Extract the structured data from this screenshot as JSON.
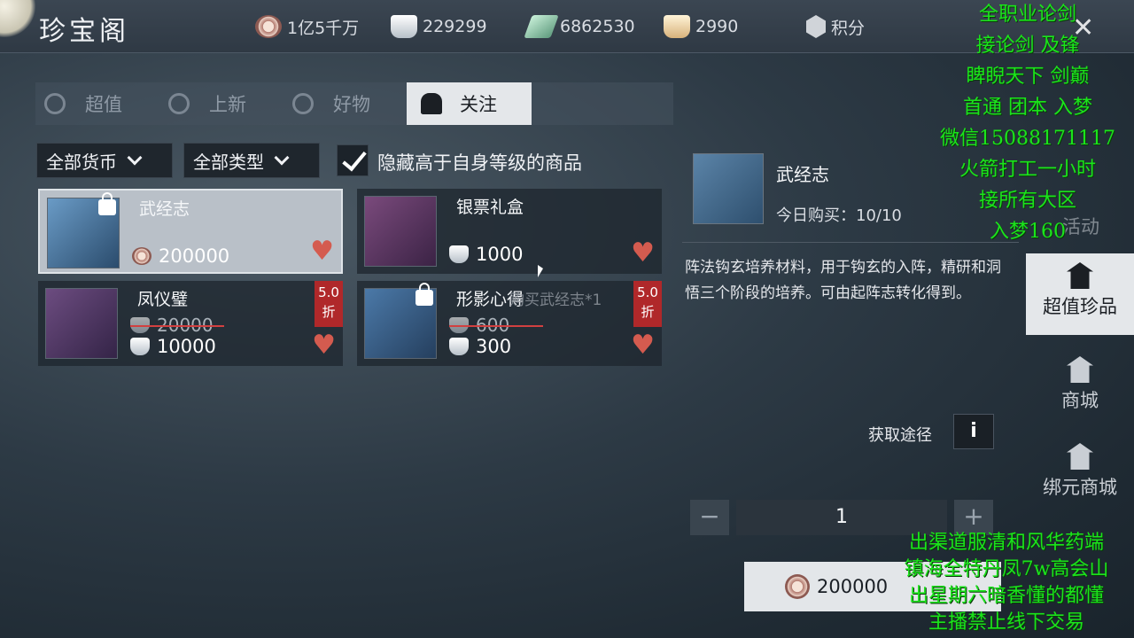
{
  "title": "珍宝阁",
  "currencies": [
    {
      "icon": "coin-icon",
      "value": "1亿5千万"
    },
    {
      "icon": "silver-ingot-icon",
      "value": "229299"
    },
    {
      "icon": "jade-icon",
      "value": "6862530"
    },
    {
      "icon": "gold-ingot-icon",
      "value": "2990"
    }
  ],
  "score_label": "积分",
  "tabs": [
    {
      "label": "超值",
      "active": false
    },
    {
      "label": "上新",
      "active": false
    },
    {
      "label": "好物",
      "active": false
    },
    {
      "label": "关注",
      "active": true
    }
  ],
  "filters": {
    "currency": "全部货币",
    "type": "全部类型",
    "hide_label": "隐藏高于自身等级的商品",
    "hide_checked": true
  },
  "items": [
    {
      "name": "武经志",
      "price": "200000",
      "locked": true,
      "selected": true
    },
    {
      "name": "银票礼盒",
      "price": "1000",
      "locked": false,
      "selected": false
    },
    {
      "name": "凤仪璧",
      "old_price": "20000",
      "price": "10000",
      "discount": [
        "5.0",
        "折"
      ]
    },
    {
      "name": "形影心得",
      "old_price": "600",
      "price": "300",
      "discount": [
        "5.0",
        "折"
      ],
      "locked": true
    }
  ],
  "tooltip": "购买武经志*1",
  "detail": {
    "name": "武经志",
    "limit": "今日购买：10/10",
    "description": "阵法钩玄培养材料，用于钩玄的入阵，精研和洞悟三个阶段的培养。可由起阵志转化得到。",
    "acquire_label": "获取途径",
    "acquire_icon": "i",
    "quantity": "1",
    "minus": "−",
    "plus": "+",
    "buy_price": "200000"
  },
  "sidenav": {
    "faded_top": "活动",
    "items": [
      {
        "label": "超值珍品",
        "active": true
      },
      {
        "label": "商城",
        "active": false
      },
      {
        "label": "绑元商城",
        "active": false
      }
    ]
  },
  "overlay_top": [
    "全职业论剑",
    "接论剑 及锋",
    "睥睨天下  剑巅",
    "首通 团本 入梦",
    "微信15088171117",
    "火箭打工一小时",
    "接所有大区",
    "入梦160"
  ],
  "overlay_bottom": [
    "出渠道服清和风华药端",
    "镇海全特丹凤7w高会山",
    "出星期六暗香懂的都懂",
    "主播禁止线下交易"
  ],
  "close_glyph": "✕",
  "colors": {
    "accent_heart": "#d45b4f",
    "discount": "#b0282a",
    "overlay_text": "#1be41b"
  }
}
